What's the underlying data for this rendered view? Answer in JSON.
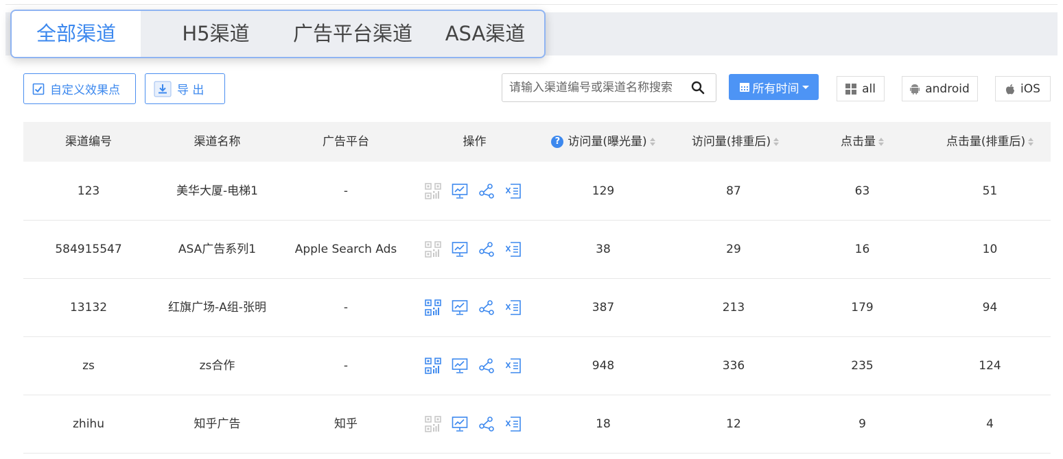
{
  "tabs": [
    {
      "label": "全部渠道",
      "active": true
    },
    {
      "label": "H5渠道",
      "active": false
    },
    {
      "label": "广告平台渠道",
      "active": false
    },
    {
      "label": "ASA渠道",
      "active": false
    }
  ],
  "toolbar": {
    "custom_effect_label": "自定义效果点",
    "export_label": "导 出",
    "search_placeholder": "请输入渠道编号或渠道名称搜索",
    "time_filter_label": "所有时间",
    "platforms": [
      {
        "label": "all",
        "icon": "grid-icon"
      },
      {
        "label": "android",
        "icon": "android-icon"
      },
      {
        "label": "iOS",
        "icon": "apple-icon"
      }
    ]
  },
  "colors": {
    "accent": "#3c88ee",
    "qr_disabled": "#c8c8c8"
  },
  "table": {
    "columns": [
      "渠道编号",
      "渠道名称",
      "广告平台",
      "操作",
      "访问量(曝光量)",
      "访问量(排重后)",
      "点击量",
      "点击量(排重后)"
    ],
    "rows": [
      {
        "id": "123",
        "name": "美华大厦-电梯1",
        "platform": "-",
        "qr_enabled": false,
        "visits": "129",
        "visits_unique": "87",
        "clicks": "63",
        "clicks_unique": "51"
      },
      {
        "id": "584915547",
        "name": "ASA广告系列1",
        "platform": "Apple Search Ads",
        "qr_enabled": false,
        "visits": "38",
        "visits_unique": "29",
        "clicks": "16",
        "clicks_unique": "10"
      },
      {
        "id": "13132",
        "name": "红旗广场-A组-张明",
        "platform": "-",
        "qr_enabled": true,
        "visits": "387",
        "visits_unique": "213",
        "clicks": "179",
        "clicks_unique": "94"
      },
      {
        "id": "zs",
        "name": "zs合作",
        "platform": "-",
        "qr_enabled": true,
        "visits": "948",
        "visits_unique": "336",
        "clicks": "235",
        "clicks_unique": "124"
      },
      {
        "id": "zhihu",
        "name": "知乎广告",
        "platform": "知乎",
        "qr_enabled": false,
        "visits": "18",
        "visits_unique": "12",
        "clicks": "9",
        "clicks_unique": "4"
      }
    ]
  }
}
